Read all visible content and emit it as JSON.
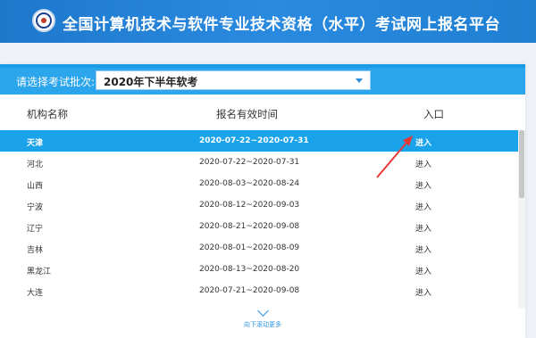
{
  "header": {
    "title": "全国计算机技术与软件专业技术资格（水平）考试网上报名平台"
  },
  "batch": {
    "label": "请选择考试批次:",
    "selected": "2020年下半年软考"
  },
  "table": {
    "columns": [
      "机构名称",
      "报名有效时间",
      "入口"
    ],
    "rows": [
      {
        "name": "天津",
        "dates": "2020-07-22~2020-07-31",
        "entry": "进入",
        "active": true
      },
      {
        "name": "河北",
        "dates": "2020-07-22~2020-07-31",
        "entry": "进入"
      },
      {
        "name": "山西",
        "dates": "2020-08-03~2020-08-24",
        "entry": "进入"
      },
      {
        "name": "宁波",
        "dates": "2020-08-12~2020-09-03",
        "entry": "进入"
      },
      {
        "name": "辽宁",
        "dates": "2020-08-21~2020-09-08",
        "entry": "进入"
      },
      {
        "name": "吉林",
        "dates": "2020-08-01~2020-08-09",
        "entry": "进入"
      },
      {
        "name": "黑龙江",
        "dates": "2020-08-13~2020-08-20",
        "entry": "进入"
      },
      {
        "name": "大连",
        "dates": "2020-07-21~2020-09-08",
        "entry": "进入"
      }
    ]
  },
  "footer": {
    "more_text": "向下滚动更多"
  },
  "colors": {
    "header": "#1f7fd1",
    "accent": "#2ba5ec",
    "active_row": "#1aa3ea",
    "annotation": "#e53935"
  },
  "icons": {
    "logo": "emblem-logo",
    "select": "chevron-down-icon",
    "more": "chevron-down-icon",
    "annotation": "red-arrow-icon"
  }
}
